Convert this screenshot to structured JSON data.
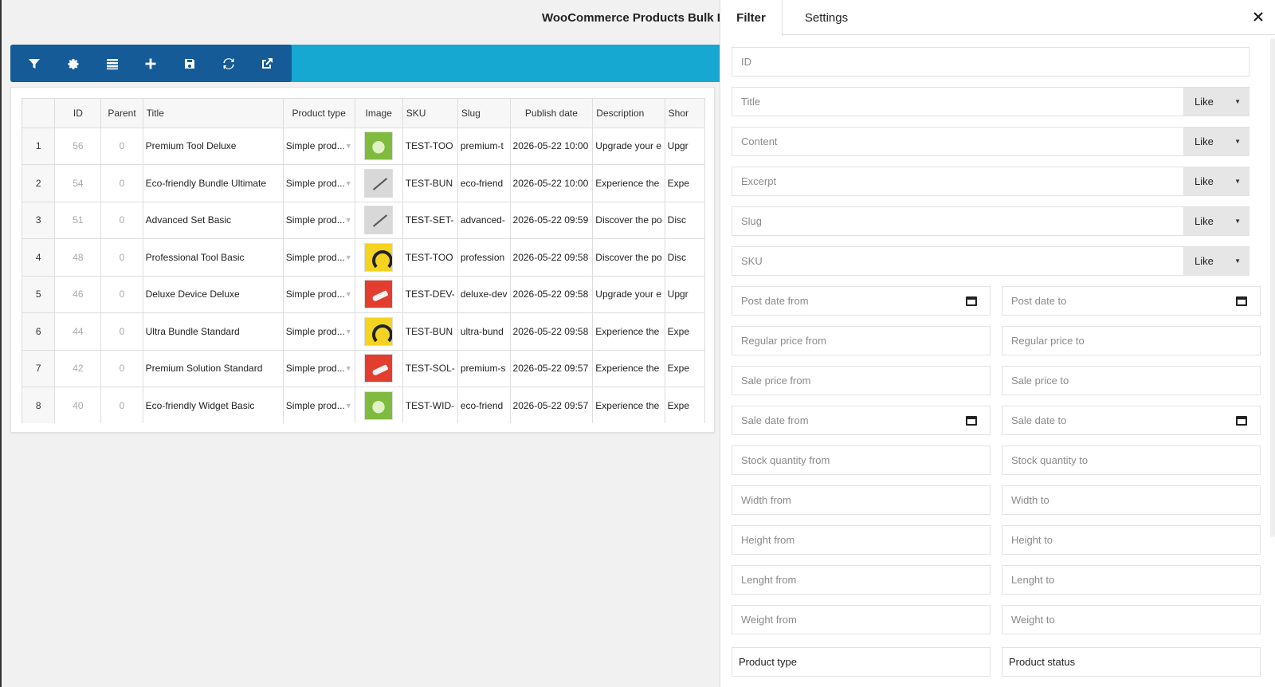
{
  "app": {
    "title": "WooCommerce Products Bulk E"
  },
  "toolbar": {
    "buttons": [
      {
        "name": "filter",
        "icon": "filter-icon"
      },
      {
        "name": "settings",
        "icon": "gear-icon"
      },
      {
        "name": "columns",
        "icon": "list-icon"
      },
      {
        "name": "add",
        "icon": "plus-icon"
      },
      {
        "name": "save",
        "icon": "save-icon"
      },
      {
        "name": "refresh",
        "icon": "refresh-icon"
      },
      {
        "name": "export",
        "icon": "external-link-icon"
      }
    ]
  },
  "grid": {
    "headers": [
      "",
      "ID",
      "Parent",
      "Title",
      "Product type",
      "Image",
      "SKU",
      "Slug",
      "Publish date",
      "Description",
      "Shor"
    ],
    "rows": [
      {
        "idx": "1",
        "id": "56",
        "parent": "0",
        "title": "Premium Tool Deluxe",
        "type": "Simple prod...",
        "image": "green",
        "sku": "TEST-TOO",
        "slug": "premium-t",
        "date": "2026-05-22 10:00",
        "desc": "Upgrade your e",
        "short": "Upgr"
      },
      {
        "idx": "2",
        "id": "54",
        "parent": "0",
        "title": "Eco-friendly Bundle Ultimate",
        "type": "Simple prod...",
        "image": "gray",
        "sku": "TEST-BUN",
        "slug": "eco-friend",
        "date": "2026-05-22 10:00",
        "desc": "Experience the",
        "short": "Expe"
      },
      {
        "idx": "3",
        "id": "51",
        "parent": "0",
        "title": "Advanced Set Basic",
        "type": "Simple prod...",
        "image": "gray",
        "sku": "TEST-SET-",
        "slug": "advanced-",
        "date": "2026-05-22 09:59",
        "desc": "Discover the po",
        "short": "Disc"
      },
      {
        "idx": "4",
        "id": "48",
        "parent": "0",
        "title": "Professional Tool Basic",
        "type": "Simple prod...",
        "image": "yellow",
        "sku": "TEST-TOO",
        "slug": "profession",
        "date": "2026-05-22 09:58",
        "desc": "Discover the po",
        "short": "Disc"
      },
      {
        "idx": "5",
        "id": "46",
        "parent": "0",
        "title": "Deluxe Device Deluxe",
        "type": "Simple prod...",
        "image": "red",
        "sku": "TEST-DEV-",
        "slug": "deluxe-dev",
        "date": "2026-05-22 09:58",
        "desc": "Upgrade your e",
        "short": "Upgr"
      },
      {
        "idx": "6",
        "id": "44",
        "parent": "0",
        "title": "Ultra Bundle Standard",
        "type": "Simple prod...",
        "image": "yellow",
        "sku": "TEST-BUN",
        "slug": "ultra-bund",
        "date": "2026-05-22 09:58",
        "desc": "Experience the",
        "short": "Expe"
      },
      {
        "idx": "7",
        "id": "42",
        "parent": "0",
        "title": "Premium Solution Standard",
        "type": "Simple prod...",
        "image": "red",
        "sku": "TEST-SOL-",
        "slug": "premium-s",
        "date": "2026-05-22 09:57",
        "desc": "Experience the",
        "short": "Expe"
      },
      {
        "idx": "8",
        "id": "40",
        "parent": "0",
        "title": "Eco-friendly Widget Basic",
        "type": "Simple prod...",
        "image": "green",
        "sku": "TEST-WID-",
        "slug": "eco-friend",
        "date": "2026-05-22 09:57",
        "desc": "Experience the",
        "short": "Expe"
      }
    ]
  },
  "panel": {
    "tabs": {
      "filter": "Filter",
      "settings": "Settings"
    },
    "like_label": "Like",
    "fields": {
      "id": "ID",
      "title": "Title",
      "content": "Content",
      "excerpt": "Excerpt",
      "slug": "Slug",
      "sku": "SKU",
      "post_date_from": "Post date from",
      "post_date_to": "Post date to",
      "regular_price_from": "Regular price from",
      "regular_price_to": "Regular price to",
      "sale_price_from": "Sale price from",
      "sale_price_to": "Sale price to",
      "sale_date_from": "Sale date from",
      "sale_date_to": "Sale date to",
      "stock_quantity_from": "Stock quantity from",
      "stock_quantity_to": "Stock quantity to",
      "width_from": "Width from",
      "width_to": "Width to",
      "height_from": "Height from",
      "height_to": "Height to",
      "lenght_from": "Lenght from",
      "lenght_to": "Lenght to",
      "weight_from": "Weight from",
      "weight_to": "Weight to",
      "product_type": "Product type",
      "product_status": "Product status"
    }
  },
  "colors": {
    "toolbar_band": "#17a8d1",
    "toolbar_dark": "#145b98"
  }
}
